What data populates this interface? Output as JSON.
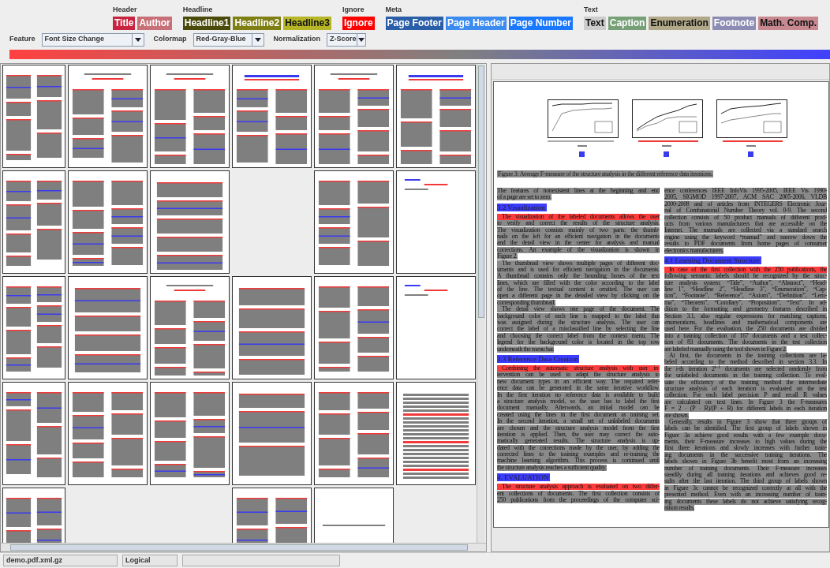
{
  "legend": [
    {
      "title": "Header",
      "items": [
        {
          "label": "Title",
          "color": "#c8233f"
        },
        {
          "label": "Author",
          "color": "#c87078"
        }
      ]
    },
    {
      "title": "Headline",
      "items": [
        {
          "label": "Headline1",
          "color": "#4a4a0a"
        },
        {
          "label": "Headline2",
          "color": "#7f7f14"
        },
        {
          "label": "Headline3",
          "color": "#b5b526"
        }
      ]
    },
    {
      "title": "Ignore",
      "items": [
        {
          "label": "Ignore",
          "color": "#ff0000"
        }
      ]
    },
    {
      "title": "Meta",
      "items": [
        {
          "label": "Page Footer",
          "color": "#2a5ea8"
        },
        {
          "label": "Page Header",
          "color": "#3c8cf0"
        },
        {
          "label": "Page Number",
          "color": "#1a78ff"
        }
      ]
    },
    {
      "title": "Text",
      "items": [
        {
          "label": "Text",
          "color": "#cccccc"
        },
        {
          "label": "Caption",
          "color": "#78a078"
        },
        {
          "label": "Enumeration",
          "color": "#b0a888"
        },
        {
          "label": "Footnote",
          "color": "#8c8cb4"
        },
        {
          "label": "Math. Comp.",
          "color": "#c88890"
        }
      ]
    }
  ],
  "toolbar": [
    {
      "label": "Feature",
      "value": "Font Size Change"
    },
    {
      "label": "Colormap",
      "value": "Red-Gray-Blue"
    },
    {
      "label": "Normalization",
      "value": "Z-Score"
    }
  ],
  "thumbnails": [
    {
      "kind": "columns"
    },
    {
      "kind": "title"
    },
    {
      "kind": "title"
    },
    {
      "kind": "header"
    },
    {
      "kind": "title"
    },
    {
      "kind": "header"
    },
    {
      "kind": "columns"
    },
    {
      "kind": "columns"
    },
    {
      "kind": "single"
    },
    {
      "kind": "empty"
    },
    {
      "kind": "columns"
    },
    {
      "kind": "sparse"
    },
    {
      "kind": "columns"
    },
    {
      "kind": "single"
    },
    {
      "kind": "title"
    },
    {
      "kind": "single"
    },
    {
      "kind": "columns"
    },
    {
      "kind": "sparse"
    },
    {
      "kind": "columns"
    },
    {
      "kind": "columns"
    },
    {
      "kind": "columns"
    },
    {
      "kind": "single"
    },
    {
      "kind": "columns"
    },
    {
      "kind": "lines"
    },
    {
      "kind": "columns"
    },
    {
      "kind": "empty"
    },
    {
      "kind": "empty"
    },
    {
      "kind": "columns"
    },
    {
      "kind": "rule"
    },
    {
      "kind": "empty"
    }
  ],
  "document": {
    "caption": "Figure 3: Average F-measure of the structure analysis in the different reference data iterations.",
    "columns": [
      [
        {
          "kind": "text",
          "text": "The features of nonexistent lines at the beginning and end"
        },
        {
          "kind": "text",
          "text": "of a page are set to zero.",
          "end": true
        },
        {
          "kind": "heading",
          "text": "3.2   Visualization"
        },
        {
          "kind": "lead",
          "text": "The visualization of the labeled documents allows the user"
        },
        {
          "kind": "text",
          "text": "to verify and correct the results of the structure analysis."
        },
        {
          "kind": "text",
          "text": "The visualization consists mainly of two parts: the thumb-"
        },
        {
          "kind": "text",
          "text": "nails on the left for an efficient navigation in the documents"
        },
        {
          "kind": "text",
          "text": "and the detail view in the center for analysis and manual"
        },
        {
          "kind": "text",
          "text": "corrections.  An example of the visualization is shown in"
        },
        {
          "kind": "text",
          "text": "Figure 2.",
          "end": true
        },
        {
          "kind": "indent",
          "text": "The thumbnail view shows multiple pages of different doc-"
        },
        {
          "kind": "text",
          "text": "uments and is used for efficient navigation in the documents."
        },
        {
          "kind": "text",
          "text": "A thumbnail contains only the bounding boxes of the text"
        },
        {
          "kind": "text",
          "text": "lines, which are filled with the color according to the label"
        },
        {
          "kind": "text",
          "text": "of the line.  The textual content is omitted.  The user can"
        },
        {
          "kind": "text",
          "text": "open a different page in the detailed view by clicking on the"
        },
        {
          "kind": "text",
          "text": "corresponding thumbnail.",
          "end": true
        },
        {
          "kind": "indent",
          "text": "The detail view shows one page of the document.  The"
        },
        {
          "kind": "text",
          "text": "background color of each line is mapped to the label that"
        },
        {
          "kind": "text",
          "text": "was assigned during the structure analysis.  The user can"
        },
        {
          "kind": "text",
          "text": "correct the label of a misclassified line by selecting the line"
        },
        {
          "kind": "text",
          "text": "and choosing the correct label from the context menu.  The"
        },
        {
          "kind": "text",
          "text": "legend for the background color is located in the top row"
        },
        {
          "kind": "text",
          "text": "underneath the menu bar.",
          "end": true
        },
        {
          "kind": "heading",
          "text": "3.3   Reference Data Creation"
        },
        {
          "kind": "lead",
          "text": "Combining the automatic structure analysis with user in-"
        },
        {
          "kind": "text",
          "text": "tervention can be used to adapt the structure analysis to"
        },
        {
          "kind": "text",
          "text": "new document types in an efficient way.  The required refer-"
        },
        {
          "kind": "text",
          "text": "ence data can be generated in the same iterative workflow."
        },
        {
          "kind": "text",
          "text": "In the first iteration no reference data is available to build"
        },
        {
          "kind": "text",
          "text": "a structure analysis model, so the user has to label the first"
        },
        {
          "kind": "text",
          "text": "document manually.  Afterwards, an initial model can be"
        },
        {
          "kind": "text",
          "text": "created using the lines in the first document as training set."
        },
        {
          "kind": "text",
          "text": "In the second iteration, a small set of unlabeled documents"
        },
        {
          "kind": "text",
          "text": "are chosen and the structure analysis model from the first"
        },
        {
          "kind": "text",
          "text": "iteration is applied.  Then, the user may correct the auto-"
        },
        {
          "kind": "text",
          "text": "matically generated results.  The structure analysis is up-"
        },
        {
          "kind": "text",
          "text": "dated with the corrections made by the user, by adding the"
        },
        {
          "kind": "text",
          "text": "corrected lines to the training examples and re-training the"
        },
        {
          "kind": "text",
          "text": "machine learning algorithm.  This process is continued until"
        },
        {
          "kind": "text",
          "text": "the structure analysis reaches a sufficient quality.",
          "end": true
        },
        {
          "kind": "heading",
          "text": "4.   EVALUATION"
        },
        {
          "kind": "lead",
          "text": "The structure analysis approach is evaluated on two differ-"
        },
        {
          "kind": "text",
          "text": "ent collections of documents.  The first collection consists of"
        },
        {
          "kind": "text",
          "text": "250 publications from the proceedings of the computer sci-"
        }
      ],
      [
        {
          "kind": "text",
          "text": "ence conferences IEEE InfoVis 1995-2005, IEEE Vis 1990-"
        },
        {
          "kind": "text",
          "text": "2005, SIGMOD 1997-2007, ACM SAC 2005-2006, VLDB"
        },
        {
          "kind": "text",
          "text": "2000-2008 and of articles from INTEGERS Electronic Jour-"
        },
        {
          "kind": "text",
          "text": "nal of Combinatorial Number Theory vol. 0-9.  The second"
        },
        {
          "kind": "text",
          "text": "collection consists of 50 product manuals of different prod-"
        },
        {
          "kind": "text",
          "text": "ucts from various manufacturers that are accessible on the"
        },
        {
          "kind": "text",
          "text": "Internet.  The manuals are collected via a standard search"
        },
        {
          "kind": "text",
          "text": "engine using the keyword “manual” and narrow down the"
        },
        {
          "kind": "text",
          "text": "results to PDF documents from home pages of consumer"
        },
        {
          "kind": "text",
          "text": "electronics manufacturers.",
          "end": true
        },
        {
          "kind": "heading",
          "text": "4.1   Learning Document Structure"
        },
        {
          "kind": "lead",
          "text": "In case of the first collection with the 250 publications, the"
        },
        {
          "kind": "text",
          "text": "following semantic labels should be recognized by the struc-"
        },
        {
          "kind": "text",
          "text": "ture analysis system: “Title”, “Author”, “Abstract”, “Head-"
        },
        {
          "kind": "text",
          "text": "line 1”, “Headline 2”, “Headline 3”, “Enumeration”, “Cap-"
        },
        {
          "kind": "text",
          "text": "tion”, “Footnote”, “Reference”, “Axiom”, “Definition”, “Lem-"
        },
        {
          "kind": "text",
          "text": "ma”, “Theorem”, “Corollary”, “Proposition”, “Text”.  In ad-"
        },
        {
          "kind": "text",
          "text": "dition to the formatting and geometry features described in"
        },
        {
          "kind": "text",
          "text": "Section 3.1, also regular expressions for matching captions,"
        },
        {
          "kind": "text",
          "text": "enumerations, headlines and mathematical components are"
        },
        {
          "kind": "text",
          "text": "used here.  For the evaluation, the 250 documents are divided"
        },
        {
          "kind": "text",
          "text": "into a training collection of 167 documents and a test collec-"
        },
        {
          "kind": "text",
          "text": "tion of 83 documents.  The documents in the test collection"
        },
        {
          "kind": "text",
          "text": "are labeled manually using the tool shown in Figure 2.",
          "end": true
        },
        {
          "kind": "indent",
          "text": "At first, the documents in the training collections are la-"
        },
        {
          "kind": "text",
          "text": "beled according to the method described in section 3.3.  In"
        },
        {
          "kind": "text",
          "text": "the i-th iteration 2$^{i−1}$ documents are selected randomly from"
        },
        {
          "kind": "text",
          "text": "the unlabeled documents in the training collection.  To eval-"
        },
        {
          "kind": "text",
          "text": "uate the efficiency of the training method the intermediate"
        },
        {
          "kind": "text",
          "text": "structure analysis of each iteration is evaluated on the test"
        },
        {
          "kind": "text",
          "text": "collection.  For each label precision P and recall R values"
        },
        {
          "kind": "text",
          "text": "are calculated on text lines.  In Figure 3 the F-measures"
        },
        {
          "kind": "text",
          "text": "F = 2 · (P · R)/(P + R) for different labels in each iteration"
        },
        {
          "kind": "text",
          "text": "are shown.",
          "end": true
        },
        {
          "kind": "indent",
          "text": "Generally, results in Figure 3 show that three groups of"
        },
        {
          "kind": "text",
          "text": "labels can be identified.  The first group of labels shown in"
        },
        {
          "kind": "text",
          "text": "Figure 3a achieve good results with a few example docu-"
        },
        {
          "kind": "text",
          "text": "ments, their F-measure increases to high values during the"
        },
        {
          "kind": "text",
          "text": "first three iterations and slowly increases with further train-"
        },
        {
          "kind": "text",
          "text": "ing documents in the successive training iterations.  The"
        },
        {
          "kind": "text",
          "text": "labels shown in Figure 3b benefit most from an increasing"
        },
        {
          "kind": "text",
          "text": "number of training documents.  Their F-measure increases"
        },
        {
          "kind": "text",
          "text": "steadily during all training iterations and achieves good re-"
        },
        {
          "kind": "text",
          "text": "sults after the last iteration.  The third group of labels shown"
        },
        {
          "kind": "text",
          "text": "in Figure 3c cannot be recognized correctly at all with the"
        },
        {
          "kind": "text",
          "text": "presented method.  Even with an increasing number of train-"
        },
        {
          "kind": "text",
          "text": "ing documents these labels do not achieve satisfying recog-"
        },
        {
          "kind": "text",
          "text": "nition results.",
          "end": true
        }
      ]
    ]
  },
  "status_bar": [
    {
      "text": "demo.pdf.xml.gz"
    },
    {
      "text": "Logical"
    }
  ]
}
